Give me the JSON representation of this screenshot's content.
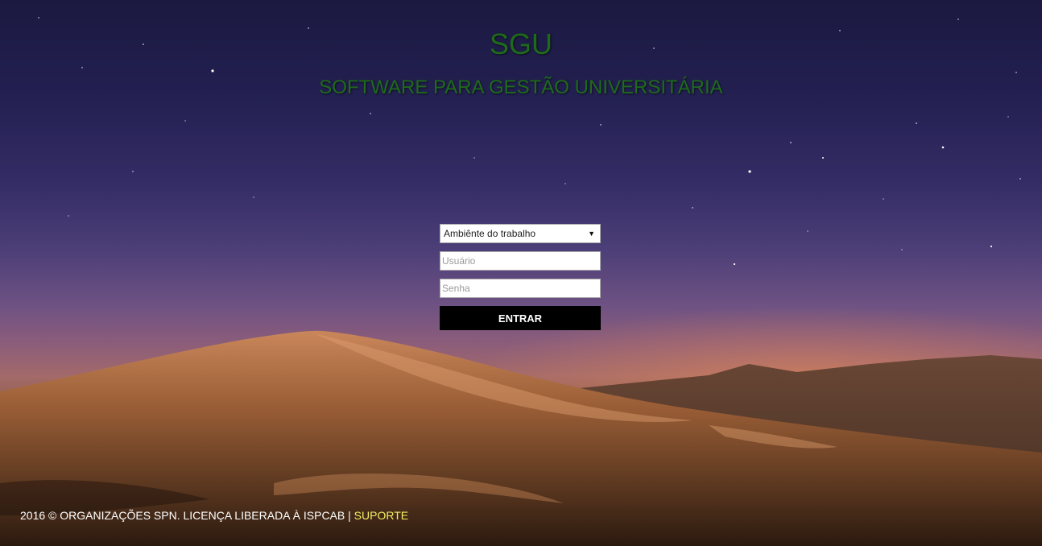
{
  "header": {
    "title": "SGU",
    "subtitle": "SOFTWARE PARA GESTÃO UNIVERSITÁRIA"
  },
  "login": {
    "environment_select": {
      "selected": "Ambiênte do trabalho"
    },
    "username": {
      "placeholder": "Usuário",
      "value": ""
    },
    "password": {
      "placeholder": "Senha",
      "value": ""
    },
    "submit_label": "ENTRAR"
  },
  "footer": {
    "text": "2016 © ORGANIZAÇÕES SPN. LICENÇA LIBERADA À ISPCAB |",
    "support_link": "SUPORTE"
  },
  "colors": {
    "title": "#1e6b1a",
    "button_bg": "#000000",
    "link": "#f2ee63"
  },
  "icons": {
    "select_arrow": "triangle-down-icon"
  }
}
